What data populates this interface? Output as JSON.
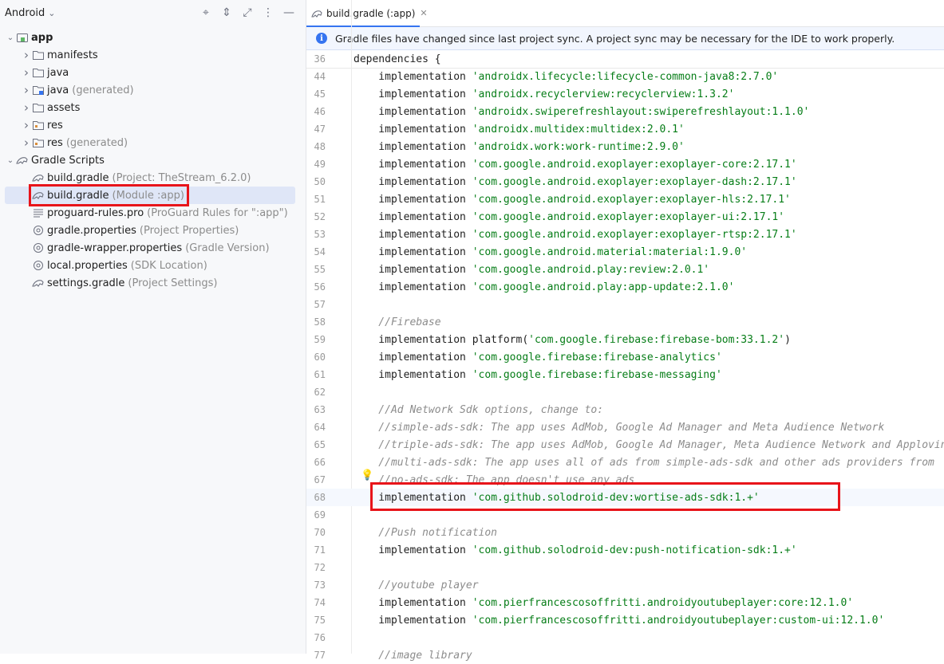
{
  "project_panel": {
    "view_mode": "Android",
    "icons": [
      "locate-icon",
      "expand-all-icon",
      "collapse-all-icon",
      "more-options-icon",
      "hide-icon"
    ],
    "tree": [
      {
        "label": "app",
        "sub": "",
        "depth": 0,
        "expanded": true,
        "icon": "module-icon",
        "bold": true
      },
      {
        "label": "manifests",
        "sub": "",
        "depth": 1,
        "expanded": false,
        "icon": "folder-icon"
      },
      {
        "label": "java",
        "sub": "",
        "depth": 1,
        "expanded": false,
        "icon": "folder-icon"
      },
      {
        "label": "java",
        "sub": "(generated)",
        "depth": 1,
        "expanded": false,
        "icon": "folder-generated-icon"
      },
      {
        "label": "assets",
        "sub": "",
        "depth": 1,
        "expanded": false,
        "icon": "folder-icon"
      },
      {
        "label": "res",
        "sub": "",
        "depth": 1,
        "expanded": false,
        "icon": "folder-res-icon"
      },
      {
        "label": "res",
        "sub": "(generated)",
        "depth": 1,
        "expanded": false,
        "icon": "folder-res-icon"
      },
      {
        "label": "Gradle Scripts",
        "sub": "",
        "depth": 0,
        "expanded": true,
        "icon": "gradle-icon"
      },
      {
        "label": "build.gradle",
        "sub": "(Project: TheStream_6.2.0)",
        "depth": 1,
        "icon": "gradle-file-icon"
      },
      {
        "label": "build.gradle",
        "sub": "(Module :app)",
        "depth": 1,
        "icon": "gradle-file-icon",
        "selected": true
      },
      {
        "label": "proguard-rules.pro",
        "sub": "(ProGuard Rules for \":app\")",
        "depth": 1,
        "icon": "text-file-icon"
      },
      {
        "label": "gradle.properties",
        "sub": "(Project Properties)",
        "depth": 1,
        "icon": "properties-icon"
      },
      {
        "label": "gradle-wrapper.properties",
        "sub": "(Gradle Version)",
        "depth": 1,
        "icon": "properties-icon"
      },
      {
        "label": "local.properties",
        "sub": "(SDK Location)",
        "depth": 1,
        "icon": "properties-icon"
      },
      {
        "label": "settings.gradle",
        "sub": "(Project Settings)",
        "depth": 1,
        "icon": "gradle-file-icon"
      }
    ]
  },
  "editor": {
    "tab_label": "build.gradle (:app)",
    "banner_text": "Gradle files have changed since last project sync. A project sync may be necessary for the IDE to work properly.",
    "sticky_line": {
      "num": "36",
      "text": "dependencies {"
    },
    "lines": [
      {
        "num": "44",
        "pre": "    implementation ",
        "str": "'androidx.lifecycle:lifecycle-common-java8:2.7.0'"
      },
      {
        "num": "45",
        "pre": "    implementation ",
        "str": "'androidx.recyclerview:recyclerview:1.3.2'"
      },
      {
        "num": "46",
        "pre": "    implementation ",
        "str": "'androidx.swiperefreshlayout:swiperefreshlayout:1.1.0'"
      },
      {
        "num": "47",
        "pre": "    implementation ",
        "str": "'androidx.multidex:multidex:2.0.1'"
      },
      {
        "num": "48",
        "pre": "    implementation ",
        "str": "'androidx.work:work-runtime:2.9.0'"
      },
      {
        "num": "49",
        "pre": "    implementation ",
        "str": "'com.google.android.exoplayer:exoplayer-core:2.17.1'"
      },
      {
        "num": "50",
        "pre": "    implementation ",
        "str": "'com.google.android.exoplayer:exoplayer-dash:2.17.1'"
      },
      {
        "num": "51",
        "pre": "    implementation ",
        "str": "'com.google.android.exoplayer:exoplayer-hls:2.17.1'"
      },
      {
        "num": "52",
        "pre": "    implementation ",
        "str": "'com.google.android.exoplayer:exoplayer-ui:2.17.1'"
      },
      {
        "num": "53",
        "pre": "    implementation ",
        "str": "'com.google.android.exoplayer:exoplayer-rtsp:2.17.1'"
      },
      {
        "num": "54",
        "pre": "    implementation ",
        "str": "'com.google.android.material:material:1.9.0'"
      },
      {
        "num": "55",
        "pre": "    implementation ",
        "str": "'com.google.android.play:review:2.0.1'"
      },
      {
        "num": "56",
        "pre": "    implementation ",
        "str": "'com.google.android.play:app-update:2.1.0'"
      },
      {
        "num": "57",
        "pre": "",
        "str": ""
      },
      {
        "num": "58",
        "comment": "    //Firebase"
      },
      {
        "num": "59",
        "pre": "    implementation platform(",
        "str": "'com.google.firebase:firebase-bom:33.1.2'",
        "post": ")"
      },
      {
        "num": "60",
        "pre": "    implementation ",
        "str": "'com.google.firebase:firebase-analytics'"
      },
      {
        "num": "61",
        "pre": "    implementation ",
        "str": "'com.google.firebase:firebase-messaging'"
      },
      {
        "num": "62",
        "pre": "",
        "str": ""
      },
      {
        "num": "63",
        "comment": "    //Ad Network Sdk options, change to:"
      },
      {
        "num": "64",
        "comment": "    //simple-ads-sdk: The app uses AdMob, Google Ad Manager and Meta Audience Network"
      },
      {
        "num": "65",
        "comment": "    //triple-ads-sdk: The app uses AdMob, Google Ad Manager, Meta Audience Network and Applovin"
      },
      {
        "num": "66",
        "comment": "    //multi-ads-sdk: The app uses all of ads from simple-ads-sdk and other ads providers from"
      },
      {
        "num": "67",
        "comment": "    //no-ads-sdk: The app doesn't use any ads"
      },
      {
        "num": "68",
        "pre": "    implementation ",
        "str": "'com.github.solodroid-dev:wortise-ads-sdk:1.+'",
        "current": true
      },
      {
        "num": "69",
        "pre": "",
        "str": ""
      },
      {
        "num": "70",
        "comment": "    //Push notification"
      },
      {
        "num": "71",
        "pre": "    implementation ",
        "str": "'com.github.solodroid-dev:push-notification-sdk:1.+'"
      },
      {
        "num": "72",
        "pre": "",
        "str": ""
      },
      {
        "num": "73",
        "comment": "    //youtube player"
      },
      {
        "num": "74",
        "pre": "    implementation ",
        "str": "'com.pierfrancescosoffritti.androidyoutubeplayer:core:12.1.0'"
      },
      {
        "num": "75",
        "pre": "    implementation ",
        "str": "'com.pierfrancescosoffritti.androidyoutubeplayer:custom-ui:12.1.0'"
      },
      {
        "num": "76",
        "pre": "",
        "str": ""
      },
      {
        "num": "77",
        "comment": "    //image library"
      }
    ]
  },
  "colors": {
    "highlight_box": "#e8141a",
    "selection": "#dfe6f7",
    "string": "#067d17",
    "comment": "#8c8c8c",
    "accent": "#3574f0"
  }
}
